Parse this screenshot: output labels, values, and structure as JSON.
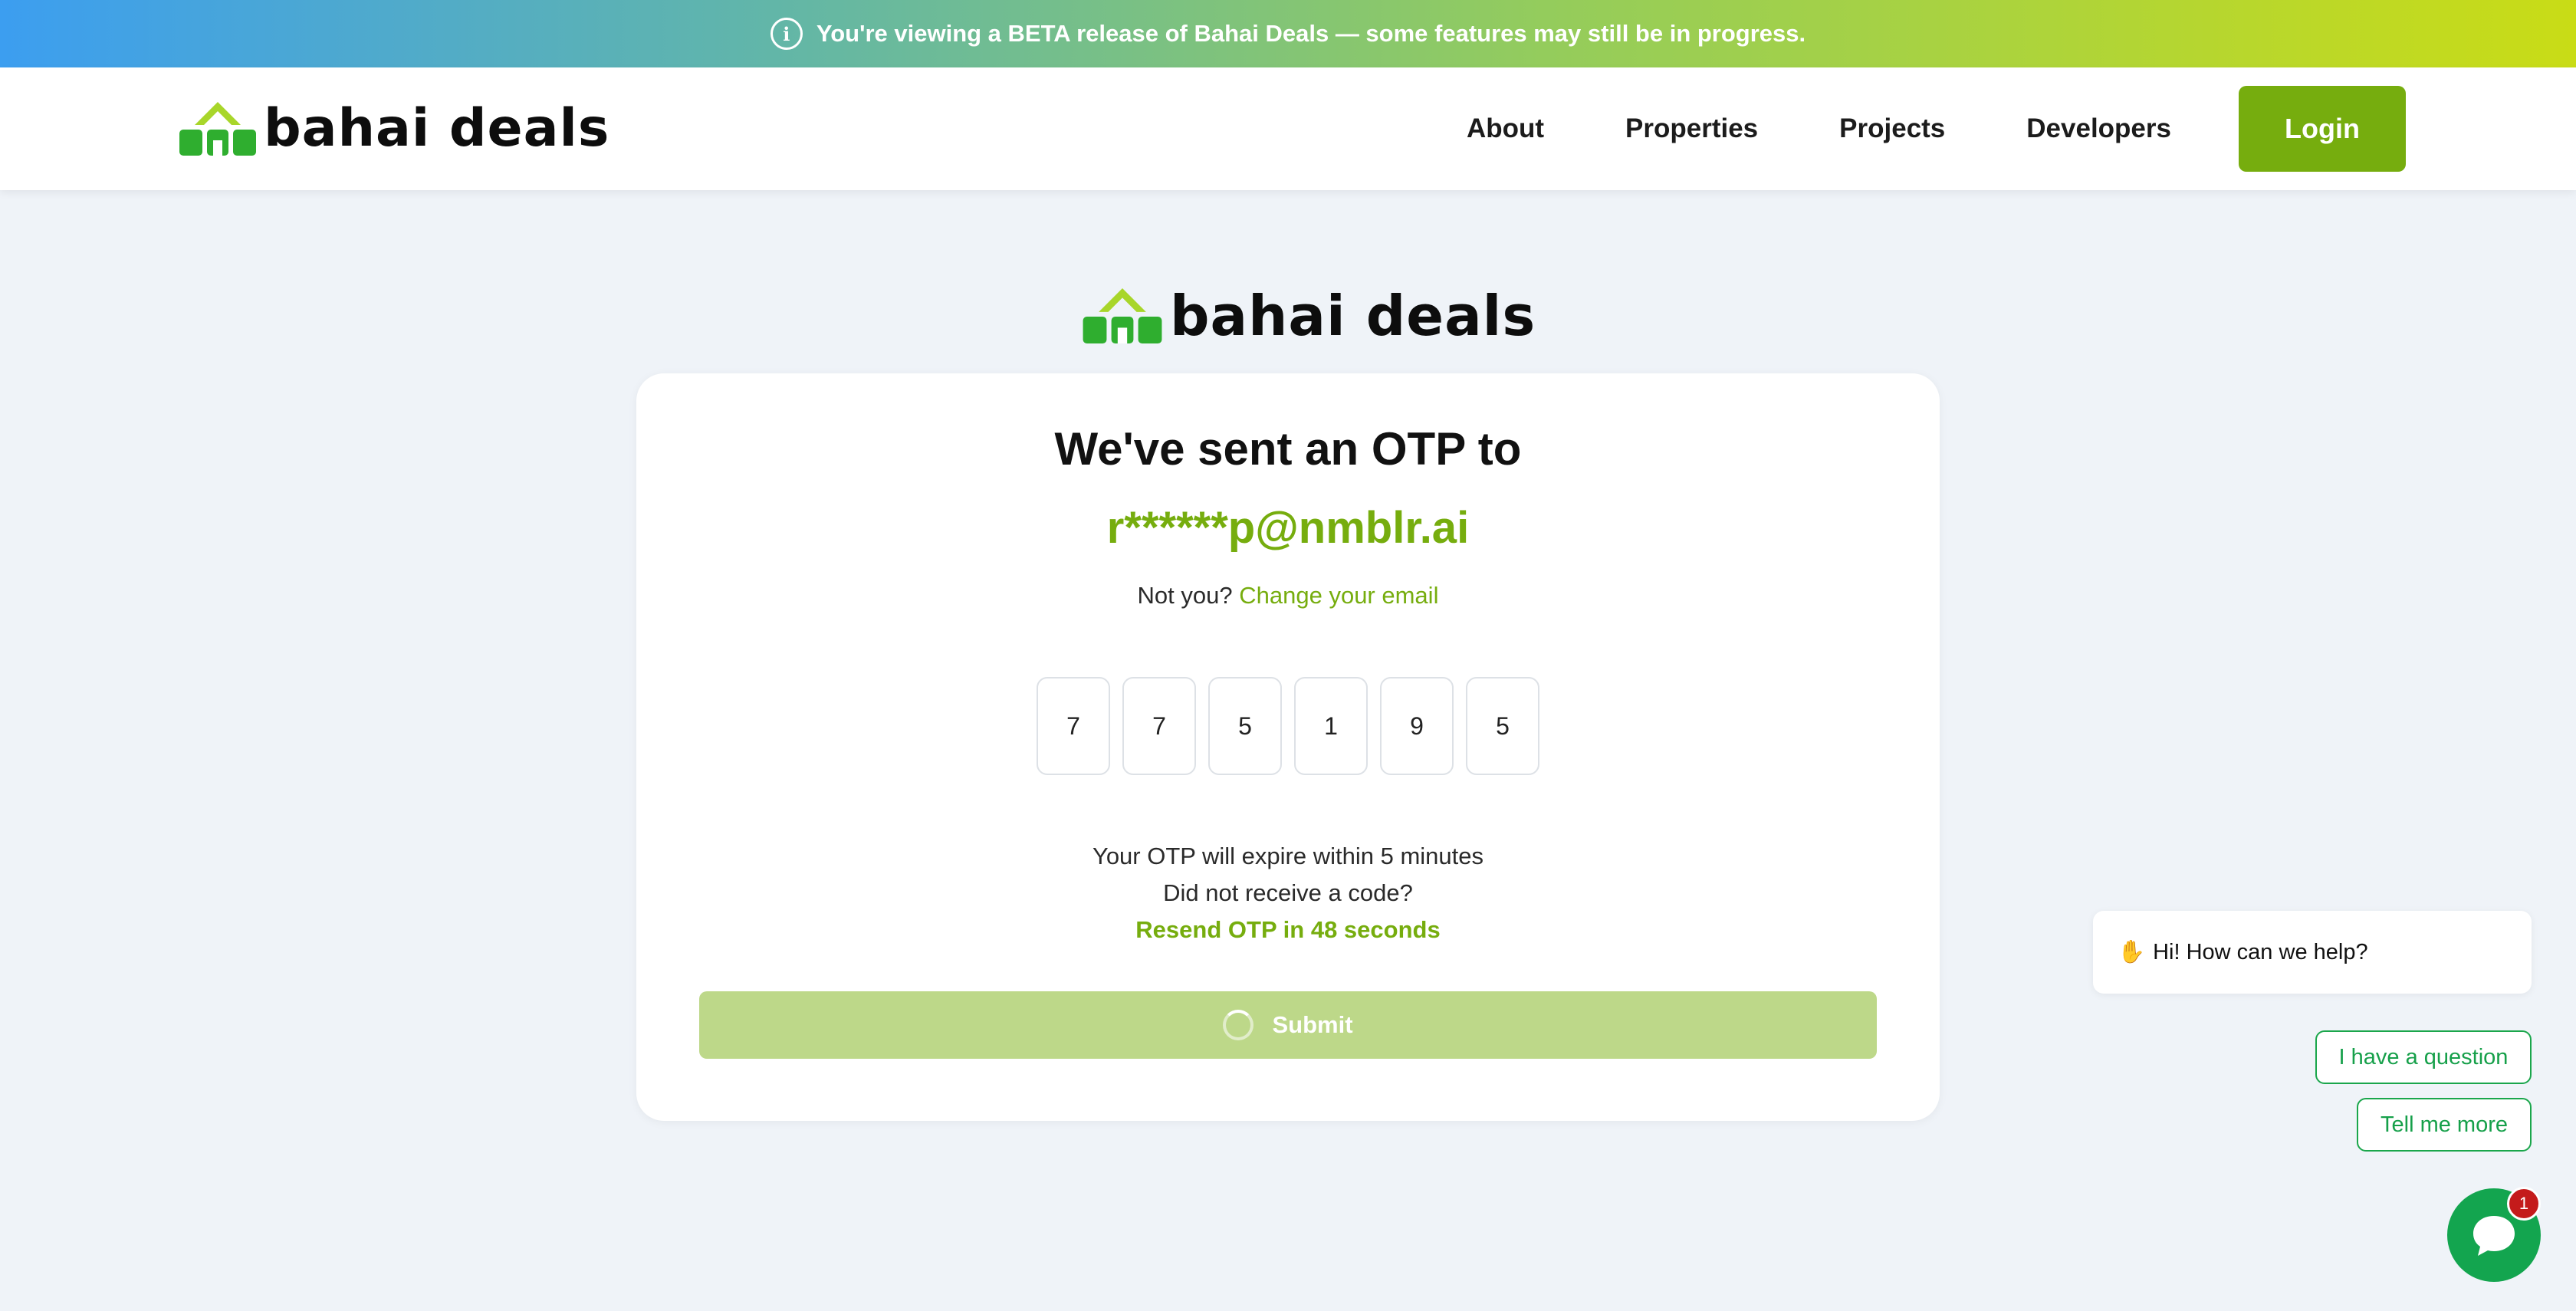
{
  "banner": {
    "icon": "info-icon",
    "text": "You're viewing a BETA release of Bahai Deals — some features may still be in progress."
  },
  "header": {
    "logo_text": "bahai deals",
    "nav": [
      "About",
      "Properties",
      "Projects",
      "Developers"
    ],
    "login_label": "Login"
  },
  "brand": {
    "logo_text": "bahai deals",
    "colors": {
      "accent": "#76ad0e",
      "logo_green_dark": "#2fae2f",
      "logo_green_light": "#a8d62a"
    }
  },
  "otp_card": {
    "title": "We've sent an OTP to",
    "email": "r******p@nmblr.ai",
    "not_you": "Not you?",
    "change_email": "Change your email",
    "digits": [
      "7",
      "7",
      "5",
      "1",
      "9",
      "5"
    ],
    "expiry": "Your OTP will expire within 5 minutes",
    "no_code": "Did not receive a code?",
    "resend": "Resend OTP in 48 seconds",
    "submit_label": "Submit"
  },
  "chat": {
    "greeting": "Hi! How can we help?",
    "greeting_icon": "waving-hand-icon",
    "options": [
      "I have a question",
      "Tell me more"
    ],
    "badge_count": "1",
    "launcher_icon": "chat-icon",
    "color": "#13a54f"
  }
}
